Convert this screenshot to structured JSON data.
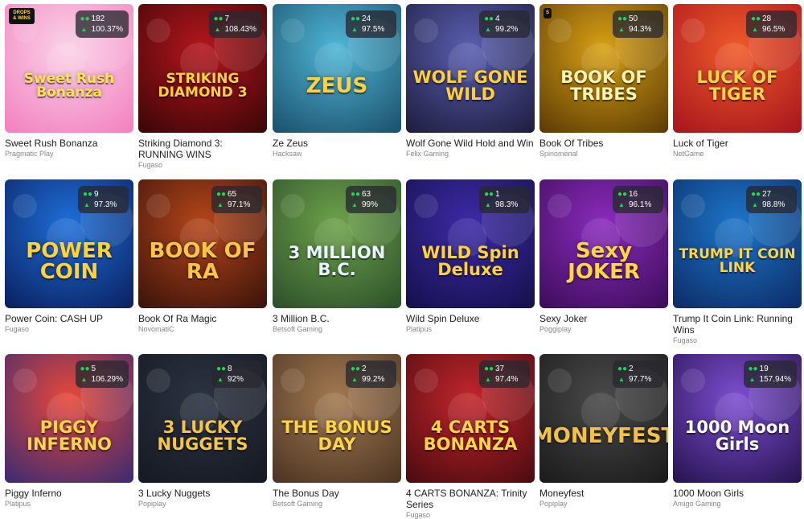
{
  "games": [
    {
      "name": "Sweet Rush Bonanza",
      "provider": "Pragmatic Play",
      "players": "182",
      "rtp": "100.37%",
      "art": "Sweet Rush Bonanza",
      "c1": "#fbd3e8",
      "c2": "#f27fbf",
      "tc": "#ffe14d",
      "sticker": "DROPS & WINS"
    },
    {
      "name": "Striking Diamond 3: RUNNING WINS",
      "provider": "Fugaso",
      "players": "7",
      "rtp": "108.43%",
      "art": "STRIKING DIAMOND 3",
      "c1": "#b3161d",
      "c2": "#3b0507",
      "tc": "#ffd23a"
    },
    {
      "name": "Ze Zeus",
      "provider": "Hacksaw",
      "players": "24",
      "rtp": "97.5%",
      "art": "ZEUS",
      "c1": "#4fb6d6",
      "c2": "#1b4f6b",
      "tc": "#f6d24a"
    },
    {
      "name": "Wolf Gone Wild Hold and Win",
      "provider": "Felix Gaming",
      "players": "4",
      "rtp": "99.2%",
      "art": "WOLF GONE WILD",
      "c1": "#5a5fb0",
      "c2": "#1d1c3d",
      "tc": "#ffcf3a"
    },
    {
      "name": "Book Of Tribes",
      "provider": "Spinomenal",
      "players": "50",
      "rtp": "94.3%",
      "art": "BOOK OF TRIBES",
      "c1": "#d9a116",
      "c2": "#5a3a05",
      "tc": "#fff3b0",
      "sticker": "S"
    },
    {
      "name": "Luck of Tiger",
      "provider": "NetGame",
      "players": "28",
      "rtp": "96.5%",
      "art": "LUCK OF TIGER",
      "c1": "#f05a2a",
      "c2": "#a6141d",
      "tc": "#ffd447"
    },
    {
      "name": "Power Coin: CASH UP",
      "provider": "Fugaso",
      "players": "9",
      "rtp": "97.3%",
      "art": "POWER COIN",
      "c1": "#1e6fd8",
      "c2": "#0b1f5e",
      "tc": "#ffd23a"
    },
    {
      "name": "Book Of Ra Magic",
      "provider": "NovomatiC",
      "players": "65",
      "rtp": "97.1%",
      "art": "BOOK OF RA",
      "c1": "#b5461b",
      "c2": "#3a120a",
      "tc": "#f7c548"
    },
    {
      "name": "3 Million B.C.",
      "provider": "Betsoft Gaming",
      "players": "63",
      "rtp": "99%",
      "art": "3 MILLION B.C.",
      "c1": "#6da24a",
      "c2": "#2c4e2a",
      "tc": "#e9f3ff"
    },
    {
      "name": "Wild Spin Deluxe",
      "provider": "Platipus",
      "players": "1",
      "rtp": "98.3%",
      "art": "WILD Spin Deluxe",
      "c1": "#3d2aa8",
      "c2": "#14104a",
      "tc": "#ffd23a"
    },
    {
      "name": "Sexy Joker",
      "provider": "Poggiplay",
      "players": "16",
      "rtp": "96.1%",
      "art": "Sexy JOKER",
      "c1": "#8b2bbd",
      "c2": "#3b0d58",
      "tc": "#ffd447"
    },
    {
      "name": "Trump It Coin Link: Running Wins",
      "provider": "Fugaso",
      "players": "27",
      "rtp": "98.8%",
      "art": "TRUMP IT COIN LINK",
      "c1": "#1d76c9",
      "c2": "#0c2b66",
      "tc": "#ffd447"
    },
    {
      "name": "Piggy Inferno",
      "provider": "Platipus",
      "players": "5",
      "rtp": "106.29%",
      "art": "PIGGY INFERNO",
      "c1": "#e8483a",
      "c2": "#3a2a72",
      "tc": "#ffd447"
    },
    {
      "name": "3 Lucky Nuggets",
      "provider": "Popiplay",
      "players": "8",
      "rtp": "92%",
      "art": "3 LUCKY NUGGETS",
      "c1": "#2c3342",
      "c2": "#141821",
      "tc": "#f3c64a"
    },
    {
      "name": "The Bonus Day",
      "provider": "Betsoft Gaming",
      "players": "2",
      "rtp": "99.2%",
      "art": "THE BONUS DAY",
      "c1": "#a37a52",
      "c2": "#4a3322",
      "tc": "#ffd447"
    },
    {
      "name": "4 CARTS BONANZA: Trinity Series",
      "provider": "Fugaso",
      "players": "37",
      "rtp": "97.4%",
      "art": "4 CARTS BONANZA",
      "c1": "#c2262c",
      "c2": "#4a0a0f",
      "tc": "#ffd447"
    },
    {
      "name": "Moneyfest",
      "provider": "Popiplay",
      "players": "2",
      "rtp": "97.7%",
      "art": "MONEYFEST",
      "c1": "#4a4a4a",
      "c2": "#1a1a1a",
      "tc": "#f2c14a"
    },
    {
      "name": "1000 Moon Girls",
      "provider": "Amigo Gaming",
      "players": "19",
      "rtp": "157.94%",
      "art": "1000 Moon Girls",
      "c1": "#7d4fd1",
      "c2": "#26124f",
      "tc": "#ffffff"
    }
  ],
  "icons": {
    "players": "people-icon",
    "rtp": "rtp-arrow-icon"
  },
  "colors": {
    "accent": "#1fd655",
    "badge_bg": "#28283080",
    "text": "#222222",
    "subtext": "#888888"
  }
}
